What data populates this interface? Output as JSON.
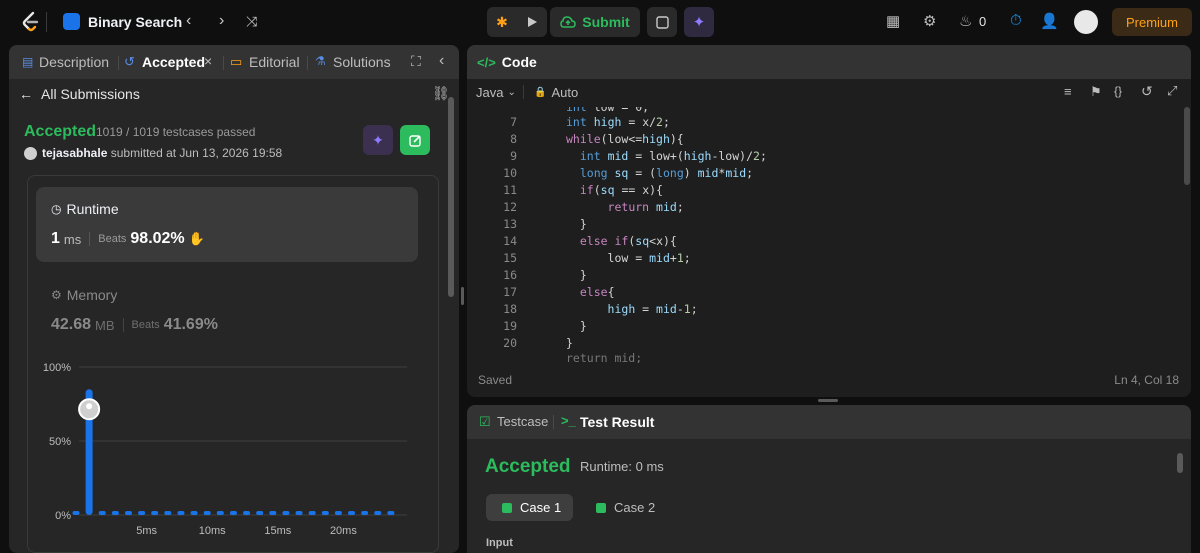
{
  "topbar": {
    "problem_title": "Binary Search",
    "submit_label": "Submit",
    "streak_count": "0",
    "premium_label": "Premium"
  },
  "left": {
    "tabs": [
      "Description",
      "Accepted",
      "Editorial",
      "Solutions"
    ],
    "back_label": "All Submissions",
    "status": "Accepted",
    "testcases": "1019 / 1019 testcases passed",
    "username": "tejasabhale",
    "submitted_text": "submitted at Jun 13, 2026 19:58",
    "runtime": {
      "label": "Runtime",
      "value": "1",
      "unit": "ms",
      "beats_label": "Beats",
      "beats_value": "98.02%"
    },
    "memory": {
      "label": "Memory",
      "value": "42.68",
      "unit": "MB",
      "beats_label": "Beats",
      "beats_value": "41.69%"
    }
  },
  "chart_data": {
    "type": "bar",
    "title": "",
    "xlabel": "",
    "ylabel": "",
    "yticks": [
      "100%",
      "50%",
      "0%"
    ],
    "xticks": [
      "5ms",
      "10ms",
      "15ms",
      "20ms"
    ],
    "ylim": [
      0,
      100
    ],
    "xlim": [
      0,
      25
    ],
    "x": [
      0,
      1,
      2,
      3,
      4,
      5,
      6,
      7,
      8,
      9,
      10,
      11,
      12,
      13,
      14,
      15,
      16,
      17,
      18,
      19,
      20,
      21,
      22,
      23,
      24
    ],
    "values": [
      0,
      85,
      0,
      0,
      0,
      0,
      0,
      0,
      0,
      0,
      0,
      0,
      0,
      0,
      0,
      0,
      0,
      0,
      0,
      0,
      0,
      0,
      0,
      0,
      0
    ],
    "highlight_x": 1,
    "color": "#1a73e8"
  },
  "code": {
    "header": "Code",
    "language": "Java",
    "mode": "Auto",
    "lines": [
      {
        "n": "7",
        "t": "        int high = x/2;"
      },
      {
        "n": "8",
        "t": "        while(low<=high){"
      },
      {
        "n": "9",
        "t": "          int mid = low+(high-low)/2;"
      },
      {
        "n": "10",
        "t": "          long sq = (long) mid*mid;"
      },
      {
        "n": "11",
        "t": "          if(sq == x){"
      },
      {
        "n": "12",
        "t": "              return mid;"
      },
      {
        "n": "13",
        "t": "          }"
      },
      {
        "n": "14",
        "t": "          else if(sq<x){"
      },
      {
        "n": "15",
        "t": "              low = mid+1;"
      },
      {
        "n": "16",
        "t": "          }"
      },
      {
        "n": "17",
        "t": "          else{"
      },
      {
        "n": "18",
        "t": "              high = mid-1;"
      },
      {
        "n": "19",
        "t": "          }"
      },
      {
        "n": "20",
        "t": "        }"
      }
    ],
    "saved": "Saved",
    "cursor": "Ln 4, Col 18"
  },
  "bottom": {
    "tab_testcase": "Testcase",
    "tab_result": "Test Result",
    "status": "Accepted",
    "runtime": "Runtime: 0 ms",
    "cases": [
      "Case 1",
      "Case 2"
    ],
    "input_label": "Input"
  }
}
